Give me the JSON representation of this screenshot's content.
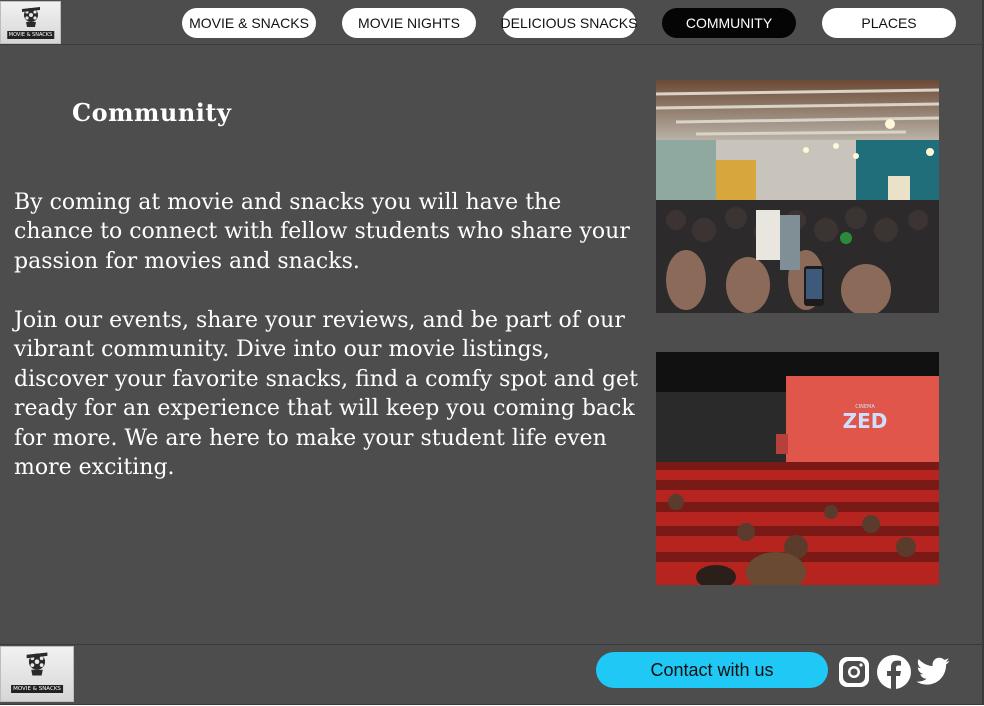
{
  "brand": {
    "logo_text": "MOVIE & SNACKS"
  },
  "nav": {
    "items": [
      {
        "label": "MOVIE & SNACKS"
      },
      {
        "label": "MOVIE NIGHTS"
      },
      {
        "label": "DELICIOUS SNACKS"
      },
      {
        "label": "COMMUNITY",
        "active": true
      },
      {
        "label": "PLACES"
      }
    ]
  },
  "main": {
    "title": "Community",
    "paragraphs": [
      "By coming at movie and snacks you will have the chance to connect with fellow students who share your passion for movies and snacks.",
      "Join our events, share your reviews, and be part of our vibrant community. Dive into our movie listings, discover your favorite snacks, find a comfy spot and get ready for an experience that will keep you coming back for more. We are here to make your student life even more exciting."
    ],
    "photos": [
      {
        "name": "community-gathering-photo"
      },
      {
        "name": "cinema-hall-photo",
        "screen_text": "ZED",
        "screen_subtext": "CINEMA"
      }
    ]
  },
  "footer": {
    "contact_label": "Contact with us",
    "social": [
      "instagram-icon",
      "facebook-icon",
      "twitter-icon"
    ]
  },
  "colors": {
    "background": "#4d4d4d",
    "nav_button": "#ffffff",
    "nav_active": "#050505",
    "contact_button": "#1fc8f5"
  }
}
